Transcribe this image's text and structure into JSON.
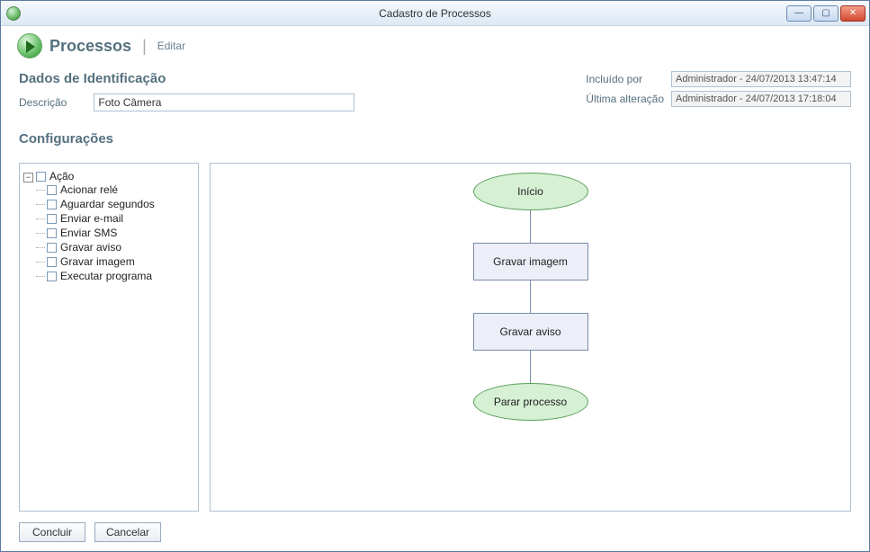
{
  "window": {
    "title": "Cadastro de Processos"
  },
  "header": {
    "title": "Processos",
    "subtitle": "Editar"
  },
  "identification": {
    "section_title": "Dados de Identificação",
    "description_label": "Descrição",
    "description_value": "Foto Câmera",
    "included_by_label": "Incluído por",
    "included_by_value": "Administrador - 24/07/2013 13:47:14",
    "last_change_label": "Última alteração",
    "last_change_value": "Administrador - 24/07/2013 17:18:04"
  },
  "config": {
    "section_title": "Configurações",
    "tree": {
      "root_label": "Ação",
      "items": [
        "Acionar relé",
        "Aguardar segundos",
        "Enviar e-mail",
        "Enviar SMS",
        "Gravar aviso",
        "Gravar imagem",
        "Executar programa"
      ]
    },
    "flow": {
      "start": "Início",
      "step1": "Gravar imagem",
      "step2": "Gravar aviso",
      "end": "Parar processo"
    }
  },
  "footer": {
    "ok": "Concluir",
    "cancel": "Cancelar"
  }
}
